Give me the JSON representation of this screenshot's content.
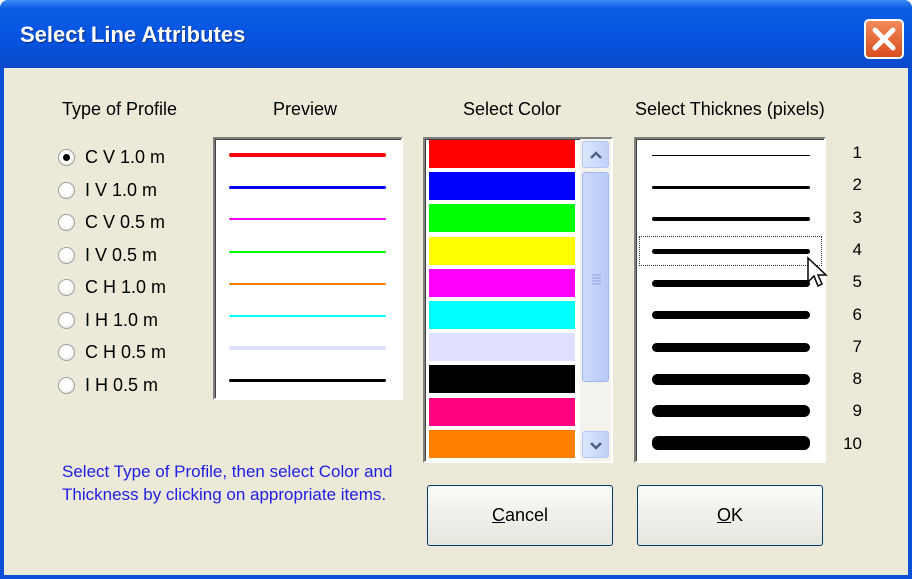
{
  "window": {
    "title": "Select Line Attributes"
  },
  "headers": {
    "type_of_profile": "Type of Profile",
    "preview": "Preview",
    "select_color": "Select Color",
    "select_thickness": "Select Thicknes  (pixels)"
  },
  "profiles": [
    {
      "label": "C V 1.0 m",
      "checked": true,
      "preview_color": "#ff0000"
    },
    {
      "label": "I V 1.0 m",
      "checked": false,
      "preview_color": "#0000ff"
    },
    {
      "label": "C V 0.5 m",
      "checked": false,
      "preview_color": "#ff00ff"
    },
    {
      "label": "I V 0.5 m",
      "checked": false,
      "preview_color": "#00ff00"
    },
    {
      "label": "C H 1.0 m",
      "checked": false,
      "preview_color": "#ff8000"
    },
    {
      "label": "I H 1.0 m",
      "checked": false,
      "preview_color": "#00ffff"
    },
    {
      "label": "C H 0.5 m",
      "checked": false,
      "preview_color": "#e0e0ff"
    },
    {
      "label": "I H 0.5 m",
      "checked": false,
      "preview_color": "#000000"
    }
  ],
  "colors": [
    "#ff0000",
    "#0000ff",
    "#00ff00",
    "#ffff00",
    "#ff00ff",
    "#00ffff",
    "#e0e0ff",
    "#000000",
    "#ff0080",
    "#ff8000"
  ],
  "thicknesses": [
    "1",
    "2",
    "3",
    "4",
    "5",
    "6",
    "7",
    "8",
    "9",
    "10"
  ],
  "selected_thickness_index": 3,
  "instructions": "Select Type of Profile, then select Color and Thickness by clicking on appropriate items.",
  "buttons": {
    "cancel": "Cancel",
    "ok": "OK"
  }
}
